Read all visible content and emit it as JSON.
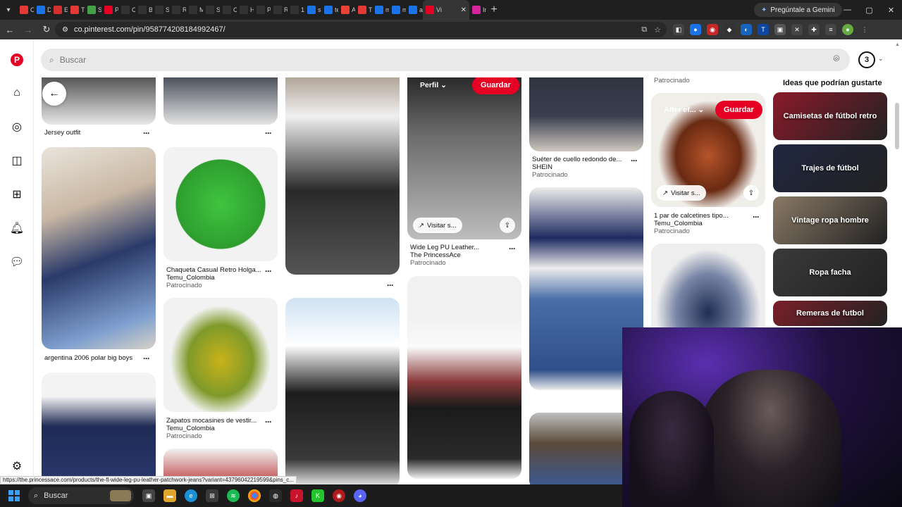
{
  "browser": {
    "tabs": [
      {
        "label": "Co",
        "color": "#e53935"
      },
      {
        "label": "D",
        "color": "#1a73e8"
      },
      {
        "label": "Es",
        "color": "#d32f2f"
      },
      {
        "label": "Ti",
        "color": "#e53935"
      },
      {
        "label": "St",
        "color": "#43a047"
      },
      {
        "label": "Pi",
        "color": "#e60023"
      },
      {
        "label": "Cc",
        "color": "#333333"
      },
      {
        "label": "Bc",
        "color": "#333333"
      },
      {
        "label": "Sl",
        "color": "#333333"
      },
      {
        "label": "Rl",
        "color": "#333333"
      },
      {
        "label": "M",
        "color": "#333333"
      },
      {
        "label": "ST",
        "color": "#333333"
      },
      {
        "label": "Cr",
        "color": "#333333"
      },
      {
        "label": "Hi",
        "color": "#333333"
      },
      {
        "label": "Pa",
        "color": "#333333"
      },
      {
        "label": "Rl",
        "color": "#333333"
      },
      {
        "label": "1",
        "color": "#333333"
      },
      {
        "label": "sh",
        "color": "#1a73e8"
      },
      {
        "label": "te",
        "color": "#1a73e8"
      },
      {
        "label": "Ai",
        "color": "#ea4335"
      },
      {
        "label": "Ti",
        "color": "#e53935"
      },
      {
        "label": "m",
        "color": "#1a73e8"
      },
      {
        "label": "m",
        "color": "#1a73e8"
      },
      {
        "label": "ar",
        "color": "#1a73e8"
      },
      {
        "label": "Vi",
        "color": "#e60023",
        "active": true
      },
      {
        "label": "In",
        "color": "#d6249f"
      }
    ],
    "gemini_label": "Pregúntale a Gemini",
    "url": "co.pinterest.com/pin/958774208184992467/",
    "status_url": "https://the.princessace.com/products/the-fl-wide-leg-pu-leather-patchwork-jeans?variant=43796042219599&pins_c..."
  },
  "search": {
    "placeholder": "Buscar"
  },
  "profile_initial": "3",
  "feed": {
    "col1": [
      {
        "title": "Jersey outfit"
      },
      {
        "title": "argentina 2006 polar big boys"
      }
    ],
    "col2": [
      {
        "title": "Chaqueta Casual Retro Holga...",
        "seller": "Temu_Colombia",
        "sponsored": "Patrocinado"
      },
      {
        "title": "Zapatos mocasines de vestir...",
        "seller": "Temu_Colombia",
        "sponsored": "Patrocinado"
      }
    ],
    "col4": {
      "perfil": "Perfil",
      "save": "Guardar",
      "visit": "Visitar s...",
      "title": "Wide Leg PU Leather...",
      "seller": "The PrincessAce",
      "sponsored": "Patrocinado"
    },
    "col5": {
      "title": "Suéter de cuello redondo de...",
      "seller": "SHEIN",
      "sponsored": "Patrocinado"
    },
    "col6": {
      "top_sponsored": "Patrocinado",
      "after": "After ef...",
      "save": "Guardar",
      "visit": "Visitar s...",
      "title": "1 par de calcetines tipo...",
      "seller": "Temu_Colombia",
      "sponsored": "Patrocinado"
    }
  },
  "ideas": {
    "title": "Ideas que podrían gustarte",
    "items": [
      {
        "label": "Camisetas de fútbol retro",
        "bg": "#8a1a2a"
      },
      {
        "label": "Trajes de fútbol",
        "bg": "#1f2740"
      },
      {
        "label": "Vintage ropa hombre",
        "bg": "#8a7a66"
      },
      {
        "label": "Ropa facha",
        "bg": "#3a3a3a"
      },
      {
        "label": "Remeras de futbol",
        "bg": "#7a1f2a"
      }
    ]
  },
  "taskbar": {
    "search_label": "Buscar"
  }
}
